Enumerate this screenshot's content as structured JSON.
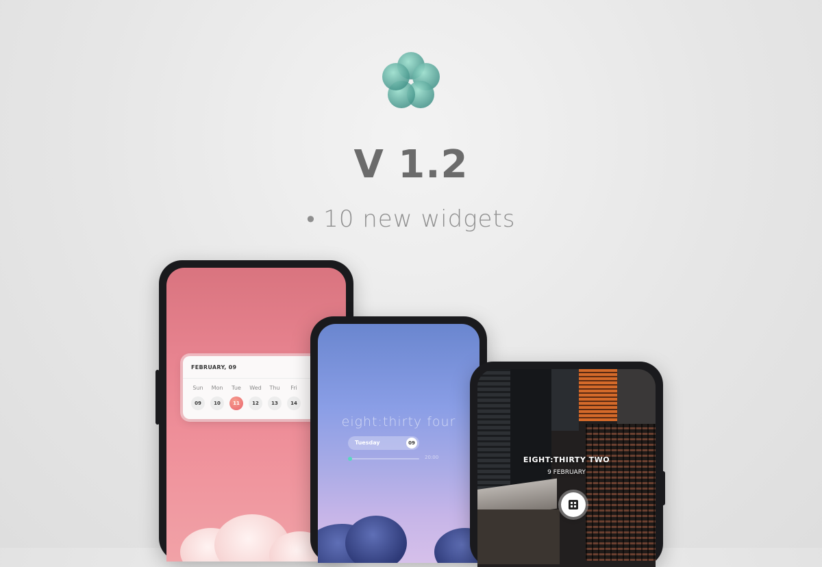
{
  "header": {
    "version": "V 1.2",
    "feature": "• 10 new widgets"
  },
  "icons": {
    "logo": "flower-logo-icon",
    "apps_button": "grid-icon"
  },
  "colors": {
    "logo_teal": "#62b8a6",
    "pink_wallpaper": "#e7838f",
    "calendar_accent": "#e9636d",
    "progress_accent": "#5ad7c0"
  },
  "phone_calendar": {
    "title": "FEBRUARY, 09",
    "days": [
      "Sun",
      "Mon",
      "Tue",
      "Wed",
      "Thu",
      "Fri"
    ],
    "dates": [
      "09",
      "10",
      "11",
      "12",
      "13",
      "14"
    ],
    "selected_index": 2
  },
  "phone_sky": {
    "clock": "eight:thirty four",
    "day": "Tuesday",
    "date": "09",
    "time_end": "20:00"
  },
  "phone_city": {
    "clock": "EIGHT:THIRTY TWO",
    "date": "9 FEBRUARY"
  }
}
